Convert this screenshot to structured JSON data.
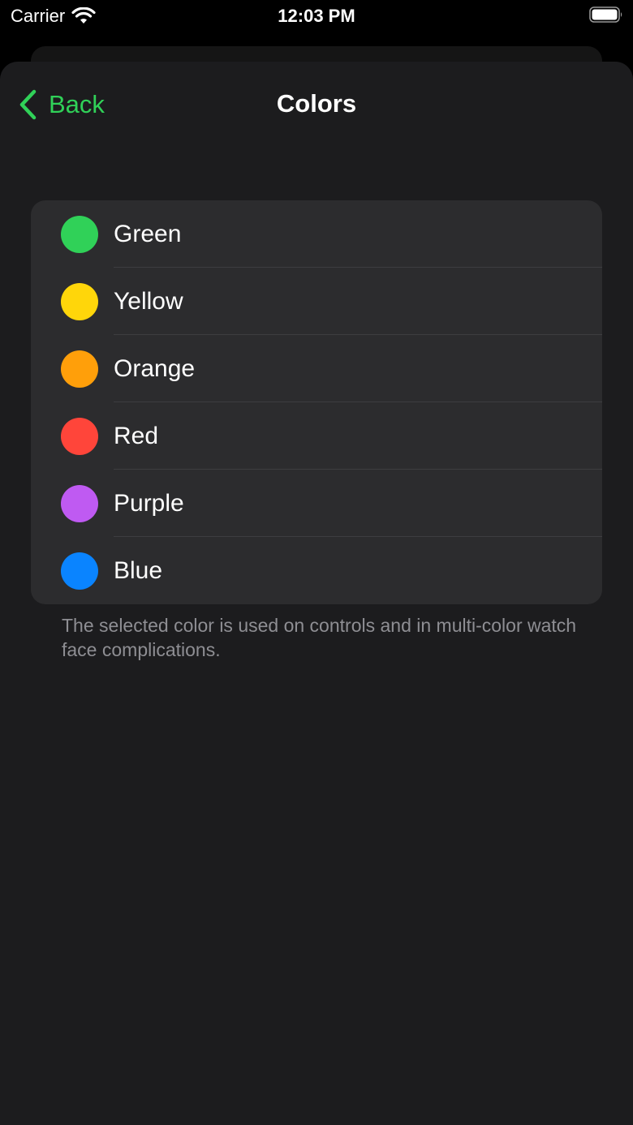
{
  "status_bar": {
    "carrier": "Carrier",
    "time": "12:03 PM",
    "icons": [
      "wifi-icon",
      "battery-icon"
    ]
  },
  "nav": {
    "back_label": "Back",
    "title": "Colors",
    "accent_color": "#30d158"
  },
  "colors": [
    {
      "label": "Green",
      "hex": "#30d158"
    },
    {
      "label": "Yellow",
      "hex": "#ffd60a"
    },
    {
      "label": "Orange",
      "hex": "#ff9f0a"
    },
    {
      "label": "Red",
      "hex": "#ff453a"
    },
    {
      "label": "Purple",
      "hex": "#bf5af2"
    },
    {
      "label": "Blue",
      "hex": "#0a84ff"
    }
  ],
  "footer_note": "The selected color is used on controls and in multi-color watch face complications."
}
